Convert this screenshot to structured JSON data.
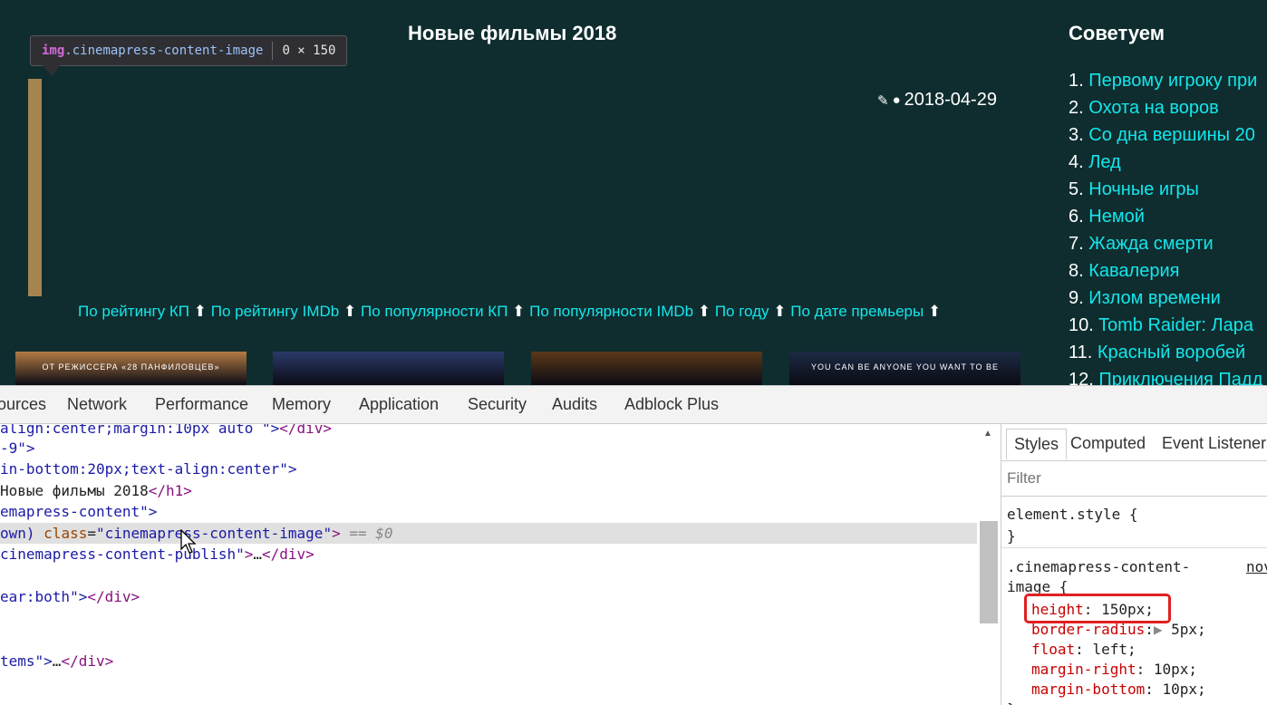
{
  "page": {
    "heading": "Новые фильмы 2018",
    "tooltip": {
      "tag": "img",
      "class": ".cinemapress-content-image",
      "size": "0 × 150"
    },
    "date": "2018-04-29",
    "sort_links": [
      "По рейтингу КП",
      "По рейтингу IMDb",
      "По популярности КП",
      "По популярности IMDb",
      "По году",
      "По дате премьеры"
    ],
    "posters": [
      {
        "caption": "ОТ РЕЖИССЕРА «28 ПАНФИЛОВЦЕВ»",
        "color": "#b47a44"
      },
      {
        "caption": "",
        "color": "#2b3a6a"
      },
      {
        "caption": "",
        "color": "#5a3818"
      },
      {
        "caption": "YOU CAN BE ANYONE YOU WANT TO BE",
        "color": "#1c2a44"
      }
    ],
    "sidebar": {
      "title": "Советуем",
      "items": [
        {
          "num": "1.",
          "label": "Первому игроку при"
        },
        {
          "num": "2.",
          "label": "Охота на воров"
        },
        {
          "num": "3.",
          "label": "Со дна вершины 20"
        },
        {
          "num": "4.",
          "label": "Лед"
        },
        {
          "num": "5.",
          "label": "Ночные игры"
        },
        {
          "num": "6.",
          "label": "Немой"
        },
        {
          "num": "7.",
          "label": "Жажда смерти"
        },
        {
          "num": "8.",
          "label": "Кавалерия"
        },
        {
          "num": "9.",
          "label": "Излом времени"
        },
        {
          "num": "10.",
          "label": "Tomb Raider: Лара"
        },
        {
          "num": "11.",
          "label": "Красный воробей"
        },
        {
          "num": "12.",
          "label": "Приключения Падд"
        }
      ]
    }
  },
  "devtools": {
    "tabs": [
      "ources",
      "Network",
      "Performance",
      "Memory",
      "Application",
      "Security",
      "Audits",
      "Adblock Plus"
    ],
    "dom_lines": {
      "l1": "align:center;margin:10px auto \">",
      "l1_close": "</div>",
      "l2": "-9\">",
      "l3": "in-bottom:20px;text-align:center\">",
      "l4_text": "Новые фильмы 2018",
      "l4_close": "</h1>",
      "l5": "emapress-content\">",
      "l6_pre": "own) ",
      "l6_attr": "class",
      "l6_val": "\"cinemapress-content-image\"",
      "l6_eq": "== $0",
      "l7_val": "cinemapress-content-publish\"",
      "l7_rest": "…",
      "l8": "ear:both\">",
      "l9": "tems\">",
      "l9_rest": "…"
    },
    "styles_tabs": [
      "Styles",
      "Computed",
      "Event Listeners"
    ],
    "filter_placeholder": "Filter",
    "rules": {
      "element_style": "element.style {",
      "close": "}",
      "selector_a": ".cinemapress-content-",
      "selector_b": "image {",
      "source": "nov",
      "props": [
        {
          "name": "height",
          "value": "150px;"
        },
        {
          "name": "border-radius",
          "value": "5px;"
        },
        {
          "name": "float",
          "value": "left;"
        },
        {
          "name": "margin-right",
          "value": "10px;"
        },
        {
          "name": "margin-bottom",
          "value": "10px;"
        }
      ]
    }
  }
}
